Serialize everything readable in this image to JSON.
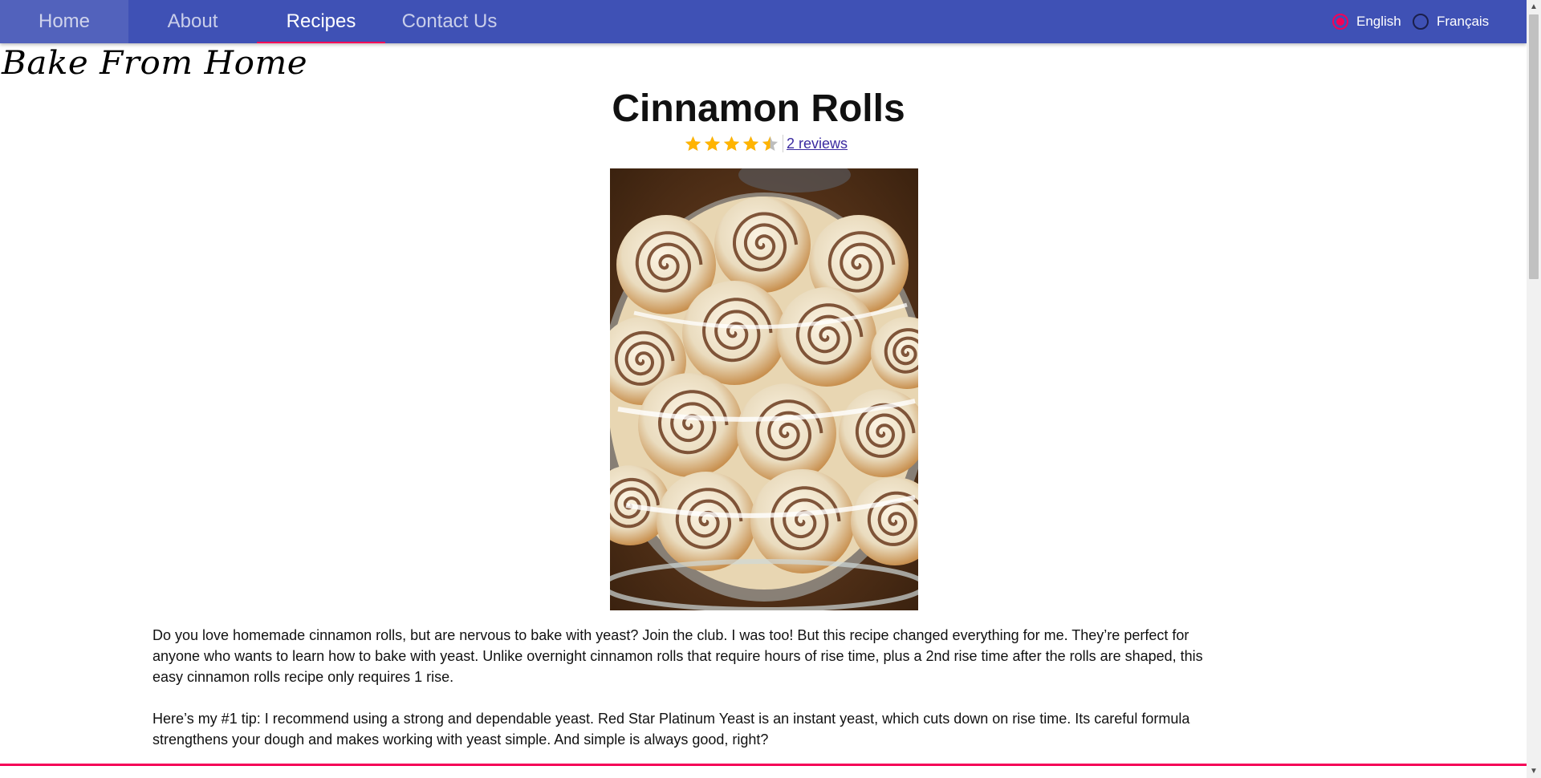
{
  "nav": {
    "items": [
      {
        "label": "Home"
      },
      {
        "label": "About"
      },
      {
        "label": "Recipes"
      },
      {
        "label": "Contact Us"
      }
    ],
    "languages": [
      {
        "label": "English",
        "checked": true
      },
      {
        "label": "Français",
        "checked": false
      }
    ]
  },
  "brand": {
    "logo_text": "Bake From Home"
  },
  "recipe": {
    "title": "Cinnamon Rolls",
    "rating": 4.5,
    "rating_max": 5,
    "reviews_link": "2 reviews",
    "paragraphs": [
      "Do you love homemade cinnamon rolls, but are nervous to bake with yeast? Join the club. I was too! But this recipe changed everything for me. They’re perfect for anyone who wants to learn how to bake with yeast. Unlike overnight cinnamon rolls that require hours of rise time, plus a 2nd rise time after the rolls are shaped, this easy cinnamon rolls recipe only requires 1 rise.",
      "Here’s my #1 tip: I recommend using a strong and dependable yeast. Red Star Platinum Yeast is an instant yeast, which cuts down on rise time. Its careful formula strengthens your dough and makes working with yeast simple. And simple is always good, right?"
    ]
  },
  "colors": {
    "navbar": "#3f51b5",
    "accent": "#f50057",
    "star": "#ffb400",
    "star_empty": "#bdbdbd"
  },
  "icons": {
    "star": "star-icon",
    "radio": "radio-icon"
  }
}
